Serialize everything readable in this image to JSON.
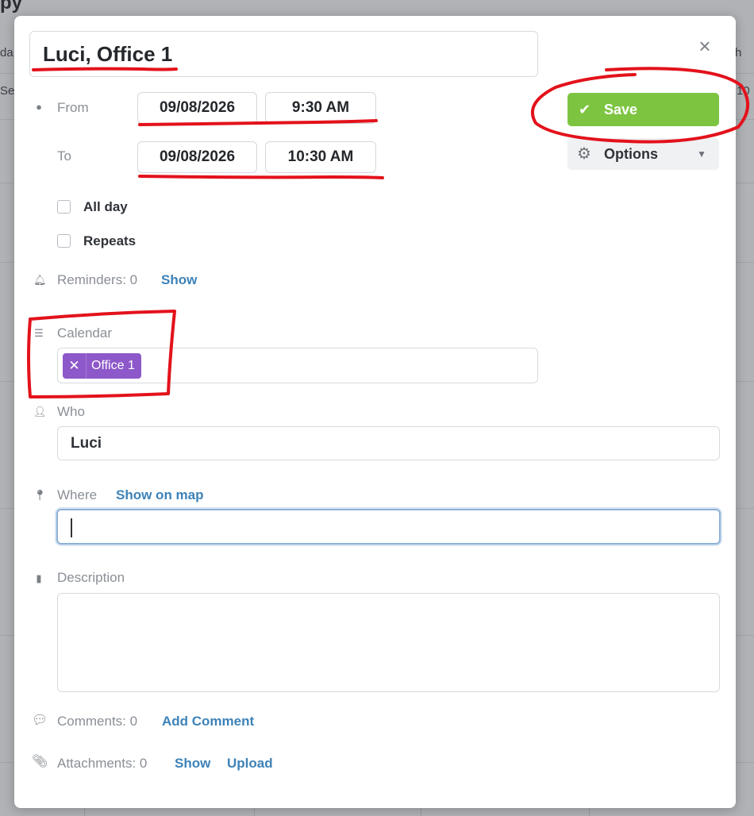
{
  "background": {
    "title_fragment": "py",
    "left_fragments": [
      "da",
      "Se"
    ],
    "right_fragments": [
      "h",
      "10"
    ]
  },
  "event": {
    "title": "Luci, Office 1",
    "close_icon": "close-icon"
  },
  "time": {
    "from_label": "From",
    "to_label": "To",
    "from_date": "09/08/2026",
    "from_time": "9:30 AM",
    "to_date": "09/08/2026",
    "to_time": "10:30 AM"
  },
  "actions": {
    "save_label": "Save",
    "options_label": "Options",
    "save_color": "#7dc541"
  },
  "checkboxes": {
    "all_day_label": "All day",
    "all_day_checked": false,
    "repeats_label": "Repeats",
    "repeats_checked": false
  },
  "reminders": {
    "label": "Reminders: 0",
    "show_link": "Show"
  },
  "calendar": {
    "label": "Calendar",
    "tags": [
      "Office 1"
    ],
    "tag_color": "#8d58c9"
  },
  "who": {
    "label": "Who",
    "value": "Luci"
  },
  "where": {
    "label": "Where",
    "map_link": "Show on map",
    "value": ""
  },
  "description": {
    "label": "Description",
    "value": ""
  },
  "comments": {
    "label": "Comments: 0",
    "add_link": "Add Comment"
  },
  "attachments": {
    "label": "Attachments: 0",
    "show_link": "Show",
    "upload_link": "Upload"
  },
  "annotation_color": "#e3121b"
}
